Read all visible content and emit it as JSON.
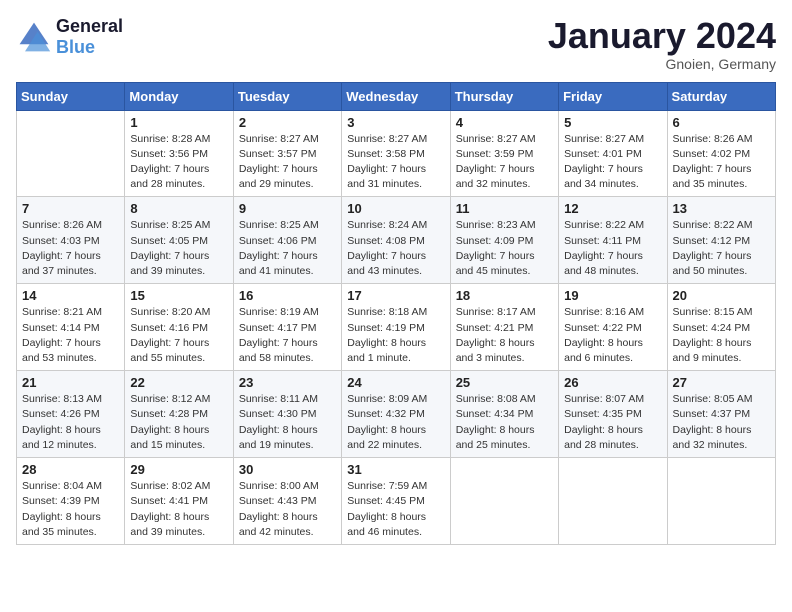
{
  "logo": {
    "line1": "General",
    "line2": "Blue"
  },
  "title": "January 2024",
  "subtitle": "Gnoien, Germany",
  "days_of_week": [
    "Sunday",
    "Monday",
    "Tuesday",
    "Wednesday",
    "Thursday",
    "Friday",
    "Saturday"
  ],
  "weeks": [
    [
      {
        "day": null
      },
      {
        "day": 1,
        "sunrise": "Sunrise: 8:28 AM",
        "sunset": "Sunset: 3:56 PM",
        "daylight": "Daylight: 7 hours and 28 minutes."
      },
      {
        "day": 2,
        "sunrise": "Sunrise: 8:27 AM",
        "sunset": "Sunset: 3:57 PM",
        "daylight": "Daylight: 7 hours and 29 minutes."
      },
      {
        "day": 3,
        "sunrise": "Sunrise: 8:27 AM",
        "sunset": "Sunset: 3:58 PM",
        "daylight": "Daylight: 7 hours and 31 minutes."
      },
      {
        "day": 4,
        "sunrise": "Sunrise: 8:27 AM",
        "sunset": "Sunset: 3:59 PM",
        "daylight": "Daylight: 7 hours and 32 minutes."
      },
      {
        "day": 5,
        "sunrise": "Sunrise: 8:27 AM",
        "sunset": "Sunset: 4:01 PM",
        "daylight": "Daylight: 7 hours and 34 minutes."
      },
      {
        "day": 6,
        "sunrise": "Sunrise: 8:26 AM",
        "sunset": "Sunset: 4:02 PM",
        "daylight": "Daylight: 7 hours and 35 minutes."
      }
    ],
    [
      {
        "day": 7,
        "sunrise": "Sunrise: 8:26 AM",
        "sunset": "Sunset: 4:03 PM",
        "daylight": "Daylight: 7 hours and 37 minutes."
      },
      {
        "day": 8,
        "sunrise": "Sunrise: 8:25 AM",
        "sunset": "Sunset: 4:05 PM",
        "daylight": "Daylight: 7 hours and 39 minutes."
      },
      {
        "day": 9,
        "sunrise": "Sunrise: 8:25 AM",
        "sunset": "Sunset: 4:06 PM",
        "daylight": "Daylight: 7 hours and 41 minutes."
      },
      {
        "day": 10,
        "sunrise": "Sunrise: 8:24 AM",
        "sunset": "Sunset: 4:08 PM",
        "daylight": "Daylight: 7 hours and 43 minutes."
      },
      {
        "day": 11,
        "sunrise": "Sunrise: 8:23 AM",
        "sunset": "Sunset: 4:09 PM",
        "daylight": "Daylight: 7 hours and 45 minutes."
      },
      {
        "day": 12,
        "sunrise": "Sunrise: 8:22 AM",
        "sunset": "Sunset: 4:11 PM",
        "daylight": "Daylight: 7 hours and 48 minutes."
      },
      {
        "day": 13,
        "sunrise": "Sunrise: 8:22 AM",
        "sunset": "Sunset: 4:12 PM",
        "daylight": "Daylight: 7 hours and 50 minutes."
      }
    ],
    [
      {
        "day": 14,
        "sunrise": "Sunrise: 8:21 AM",
        "sunset": "Sunset: 4:14 PM",
        "daylight": "Daylight: 7 hours and 53 minutes."
      },
      {
        "day": 15,
        "sunrise": "Sunrise: 8:20 AM",
        "sunset": "Sunset: 4:16 PM",
        "daylight": "Daylight: 7 hours and 55 minutes."
      },
      {
        "day": 16,
        "sunrise": "Sunrise: 8:19 AM",
        "sunset": "Sunset: 4:17 PM",
        "daylight": "Daylight: 7 hours and 58 minutes."
      },
      {
        "day": 17,
        "sunrise": "Sunrise: 8:18 AM",
        "sunset": "Sunset: 4:19 PM",
        "daylight": "Daylight: 8 hours and 1 minute."
      },
      {
        "day": 18,
        "sunrise": "Sunrise: 8:17 AM",
        "sunset": "Sunset: 4:21 PM",
        "daylight": "Daylight: 8 hours and 3 minutes."
      },
      {
        "day": 19,
        "sunrise": "Sunrise: 8:16 AM",
        "sunset": "Sunset: 4:22 PM",
        "daylight": "Daylight: 8 hours and 6 minutes."
      },
      {
        "day": 20,
        "sunrise": "Sunrise: 8:15 AM",
        "sunset": "Sunset: 4:24 PM",
        "daylight": "Daylight: 8 hours and 9 minutes."
      }
    ],
    [
      {
        "day": 21,
        "sunrise": "Sunrise: 8:13 AM",
        "sunset": "Sunset: 4:26 PM",
        "daylight": "Daylight: 8 hours and 12 minutes."
      },
      {
        "day": 22,
        "sunrise": "Sunrise: 8:12 AM",
        "sunset": "Sunset: 4:28 PM",
        "daylight": "Daylight: 8 hours and 15 minutes."
      },
      {
        "day": 23,
        "sunrise": "Sunrise: 8:11 AM",
        "sunset": "Sunset: 4:30 PM",
        "daylight": "Daylight: 8 hours and 19 minutes."
      },
      {
        "day": 24,
        "sunrise": "Sunrise: 8:09 AM",
        "sunset": "Sunset: 4:32 PM",
        "daylight": "Daylight: 8 hours and 22 minutes."
      },
      {
        "day": 25,
        "sunrise": "Sunrise: 8:08 AM",
        "sunset": "Sunset: 4:34 PM",
        "daylight": "Daylight: 8 hours and 25 minutes."
      },
      {
        "day": 26,
        "sunrise": "Sunrise: 8:07 AM",
        "sunset": "Sunset: 4:35 PM",
        "daylight": "Daylight: 8 hours and 28 minutes."
      },
      {
        "day": 27,
        "sunrise": "Sunrise: 8:05 AM",
        "sunset": "Sunset: 4:37 PM",
        "daylight": "Daylight: 8 hours and 32 minutes."
      }
    ],
    [
      {
        "day": 28,
        "sunrise": "Sunrise: 8:04 AM",
        "sunset": "Sunset: 4:39 PM",
        "daylight": "Daylight: 8 hours and 35 minutes."
      },
      {
        "day": 29,
        "sunrise": "Sunrise: 8:02 AM",
        "sunset": "Sunset: 4:41 PM",
        "daylight": "Daylight: 8 hours and 39 minutes."
      },
      {
        "day": 30,
        "sunrise": "Sunrise: 8:00 AM",
        "sunset": "Sunset: 4:43 PM",
        "daylight": "Daylight: 8 hours and 42 minutes."
      },
      {
        "day": 31,
        "sunrise": "Sunrise: 7:59 AM",
        "sunset": "Sunset: 4:45 PM",
        "daylight": "Daylight: 8 hours and 46 minutes."
      },
      {
        "day": null
      },
      {
        "day": null
      },
      {
        "day": null
      }
    ]
  ]
}
